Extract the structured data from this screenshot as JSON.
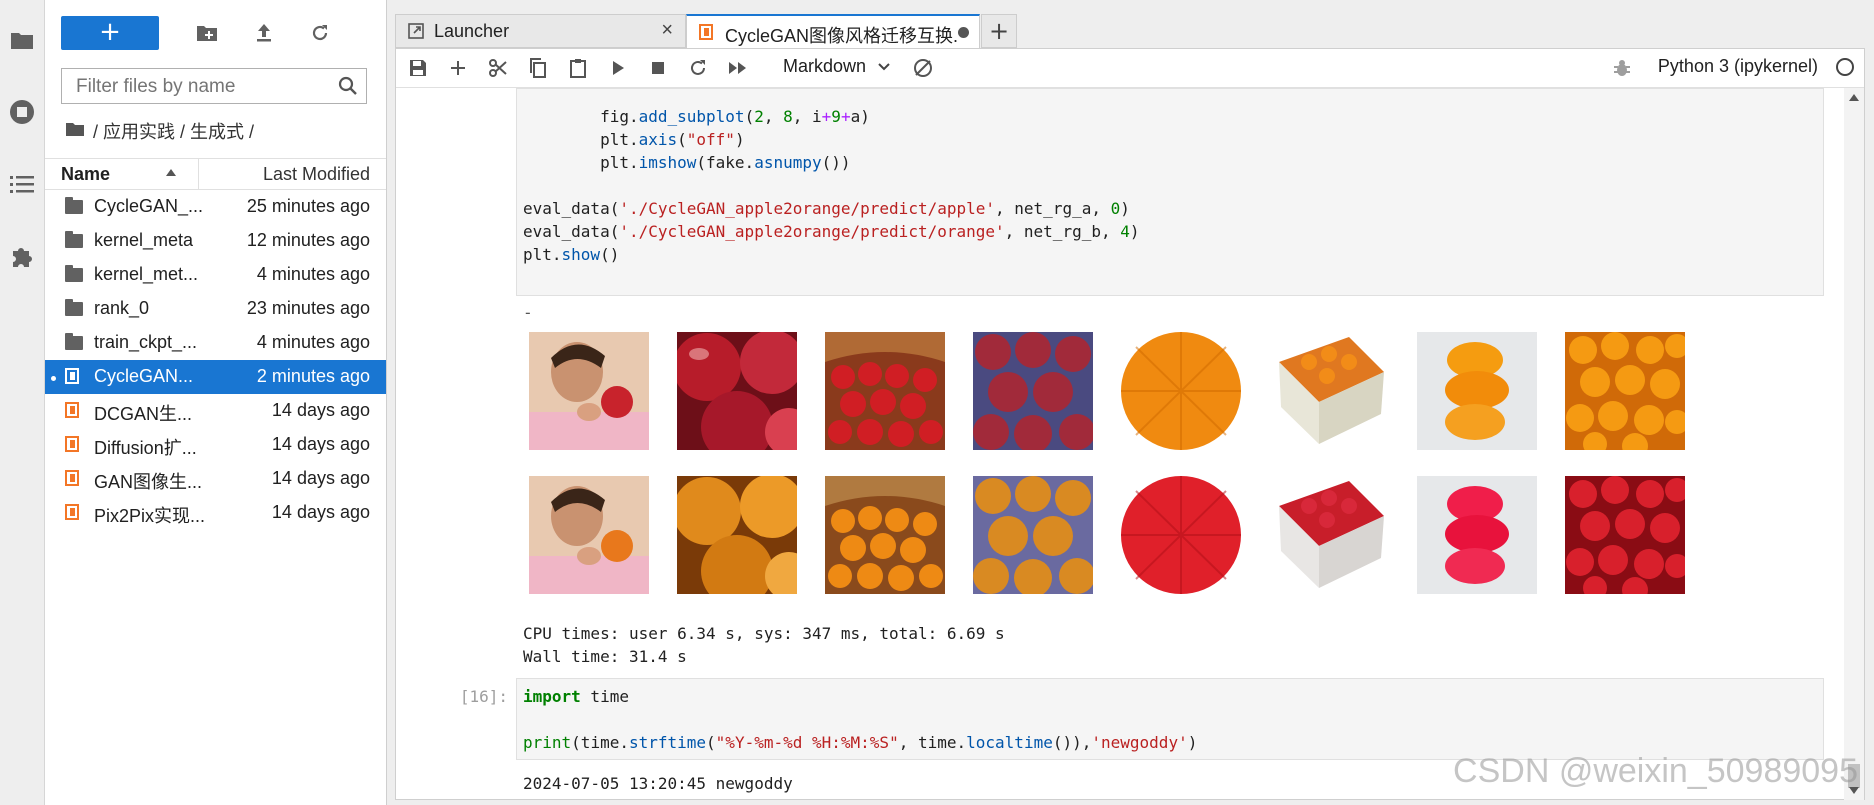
{
  "colors": {
    "accent": "#1976d2",
    "notebook_orange": "#f37626",
    "string_red": "#ba2121",
    "keyword_green": "#008000",
    "func_blue": "#0055aa"
  },
  "sidebar": {
    "icons": [
      "folder-icon",
      "running-icon",
      "toc-icon",
      "extensions-icon"
    ]
  },
  "filebrowser": {
    "new_label": "+",
    "filter_placeholder": "Filter files by name",
    "breadcrumb": "/ 应用实践 / 生成式 /",
    "col_name": "Name",
    "col_modified": "Last Modified",
    "items": [
      {
        "name": "CycleGAN_...",
        "modified": "25 minutes ago",
        "type": "folder"
      },
      {
        "name": "kernel_meta",
        "modified": "12 minutes ago",
        "type": "folder"
      },
      {
        "name": "kernel_met...",
        "modified": "4 minutes ago",
        "type": "folder"
      },
      {
        "name": "rank_0",
        "modified": "23 minutes ago",
        "type": "folder"
      },
      {
        "name": "train_ckpt_...",
        "modified": "4 minutes ago",
        "type": "folder"
      },
      {
        "name": "CycleGAN...",
        "modified": "2 minutes ago",
        "type": "notebook",
        "selected": true
      },
      {
        "name": "DCGAN生...",
        "modified": "14 days ago",
        "type": "notebook"
      },
      {
        "name": "Diffusion扩...",
        "modified": "14 days ago",
        "type": "notebook"
      },
      {
        "name": "GAN图像生...",
        "modified": "14 days ago",
        "type": "notebook"
      },
      {
        "name": "Pix2Pix实现...",
        "modified": "14 days ago",
        "type": "notebook"
      }
    ]
  },
  "tabs": [
    {
      "label": "Launcher",
      "active": false
    },
    {
      "label": "CycleGAN图像风格迁移互换.",
      "active": true
    }
  ],
  "notebook_toolbar": {
    "cell_type": "Markdown",
    "kernel": "Python 3 (ipykernel)"
  },
  "cells": {
    "code1": [
      "        fig.add_subplot(2, 8, i+9+a)",
      "        plt.axis(\"off\")",
      "        plt.imshow(fake.asnumpy())",
      "",
      "eval_data('./CycleGAN_apple2orange/predict/apple', net_rg_a, 0)",
      "eval_data('./CycleGAN_apple2orange/predict/orange', net_rg_b, 4)",
      "plt.show()"
    ],
    "output_dash": "-",
    "image_grid": {
      "row1": [
        "woman eating apple",
        "red apples close-up",
        "basket of red apples",
        "red apples pile",
        "orange peel close-up",
        "box of oranges",
        "stacked oranges",
        "pile of oranges"
      ],
      "row2": [
        "woman eating orange",
        "orange-toned fruit close-up",
        "basket of oranges",
        "orange-toned pile",
        "red peel close-up",
        "box of red fruit",
        "stacked red fruit",
        "pile of red apples"
      ]
    },
    "cpu_times": "CPU times: user 6.34 s, sys: 347 ms, total: 6.69 s",
    "wall_time": "Wall time: 31.4 s",
    "prompt16": "[16]:",
    "code2_line1_kw": "import",
    "code2_line1_rest": " time",
    "code2_line2": "print(time.strftime(\"%Y-%m-%d %H:%M:%S\", time.localtime()),'newgoddy')",
    "output2": "2024-07-05 13:20:45 newgoddy"
  },
  "watermark": "CSDN @weixin_50989095"
}
